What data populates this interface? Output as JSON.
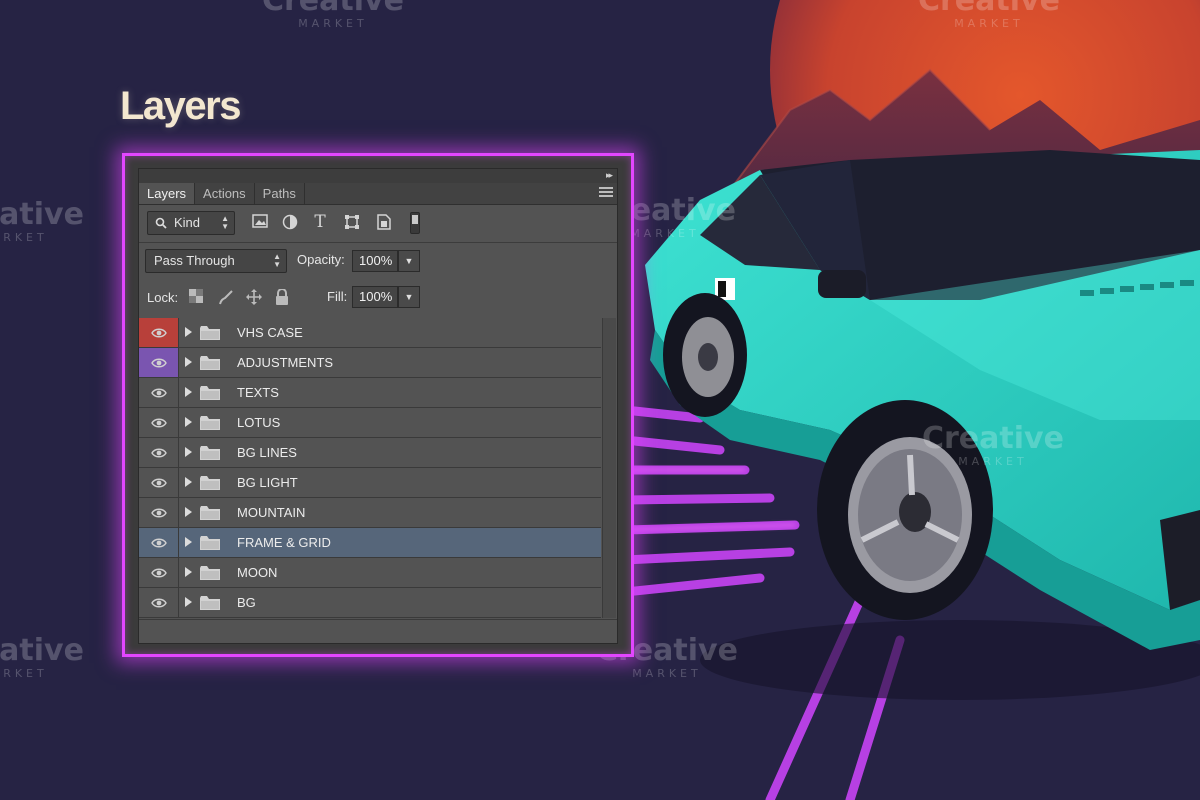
{
  "title": "Layers",
  "watermark": {
    "word": "Creative",
    "sub": "MARKET"
  },
  "colors": {
    "background": "#262344",
    "panel_glow": "#e246ff",
    "car": "#2fd6c8",
    "moon": "#d0482a",
    "grid_lines": "#d146ff"
  },
  "panel": {
    "tabs": [
      {
        "label": "Layers",
        "active": true
      },
      {
        "label": "Actions",
        "active": false
      },
      {
        "label": "Paths",
        "active": false
      }
    ],
    "filter": {
      "kind_label": "Kind"
    },
    "filter_icons": [
      "image-filter-icon",
      "adjustment-filter-icon",
      "type-filter-icon",
      "shape-filter-icon",
      "smart-object-filter-icon"
    ],
    "blend_mode": "Pass Through",
    "opacity_label": "Opacity:",
    "opacity_value": "100%",
    "lock_label": "Lock:",
    "lock_icons": [
      "lock-transparent-icon",
      "lock-image-icon",
      "lock-position-icon",
      "lock-all-icon"
    ],
    "fill_label": "Fill:",
    "fill_value": "100%",
    "layers": [
      {
        "name": "VHS CASE",
        "color": "#b8403a",
        "selected": false
      },
      {
        "name": "ADJUSTMENTS",
        "color": "#7a55b0",
        "selected": false
      },
      {
        "name": "TEXTS",
        "color": "",
        "selected": false
      },
      {
        "name": "LOTUS",
        "color": "",
        "selected": false
      },
      {
        "name": "BG LINES",
        "color": "",
        "selected": false
      },
      {
        "name": "BG LIGHT",
        "color": "",
        "selected": false
      },
      {
        "name": "MOUNTAIN",
        "color": "",
        "selected": false
      },
      {
        "name": "FRAME & GRID",
        "color": "",
        "selected": true
      },
      {
        "name": "MOON",
        "color": "",
        "selected": false
      },
      {
        "name": "BG",
        "color": "",
        "selected": false
      }
    ]
  }
}
